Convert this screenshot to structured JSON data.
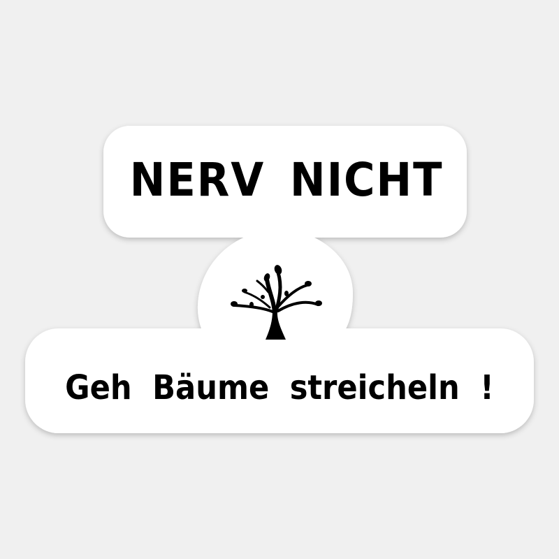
{
  "sticker": {
    "headline": "NERV NICHT",
    "subline": "Geh Bäume streicheln !",
    "illustration": "tree-icon"
  },
  "colors": {
    "background": "#f0f0f0",
    "sticker": "#ffffff",
    "text": "#000000"
  }
}
